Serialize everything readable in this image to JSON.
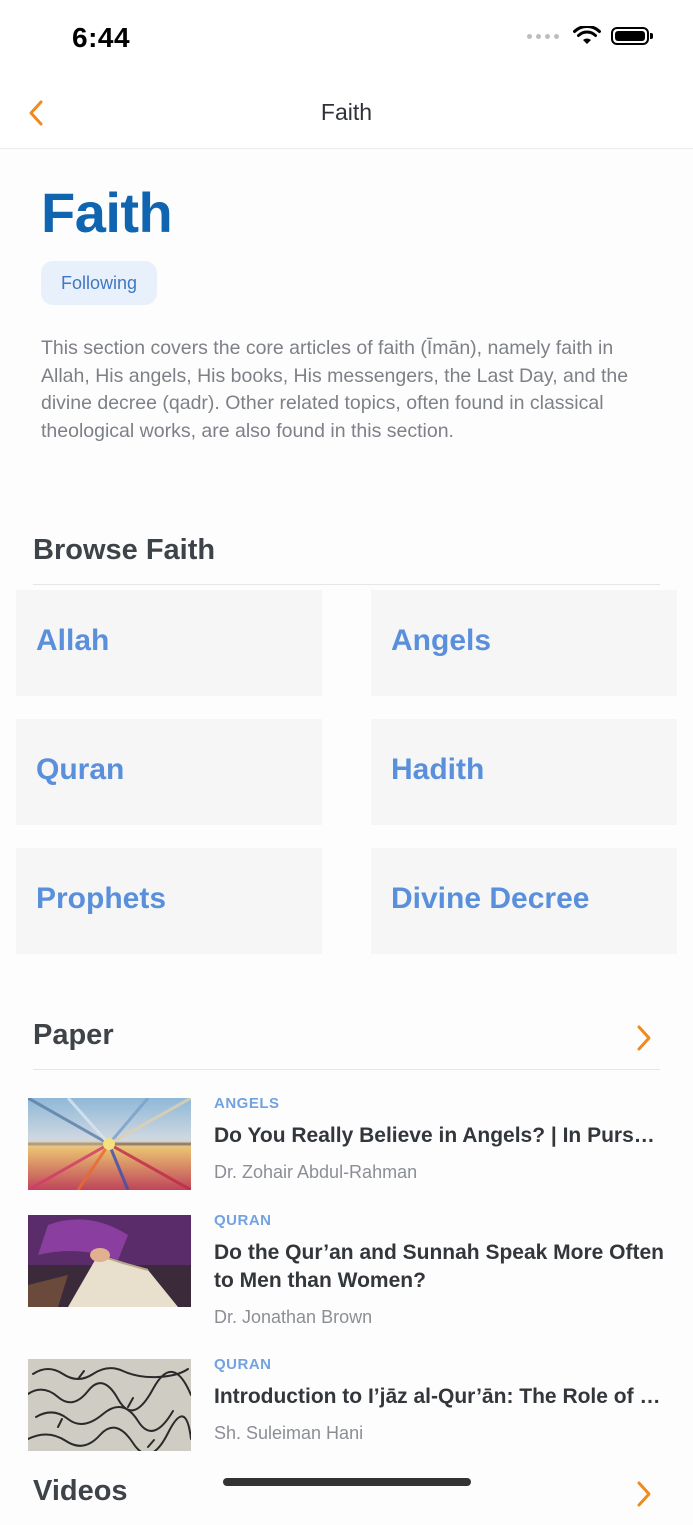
{
  "status": {
    "time": "6:44"
  },
  "nav": {
    "title": "Faith"
  },
  "header": {
    "title": "Faith",
    "follow_label": "Following",
    "description": "This section covers the core articles of faith (Īmān), namely faith in Allah, His angels, His books, His messengers, the Last Day, and the divine decree (qadr). Other related topics, often found in classical theological works, are also found in this section."
  },
  "browse": {
    "title": "Browse Faith",
    "tiles": [
      "Allah",
      "Angels",
      "Quran",
      "Hadith",
      "Prophets",
      "Divine Decree"
    ]
  },
  "paper": {
    "title": "Paper",
    "articles": [
      {
        "category": "ANGELS",
        "title": "Do You Really Believe in Angels? | In Pursuit of Certainty",
        "author": "Dr. Zohair Abdul-Rahman"
      },
      {
        "category": "QURAN",
        "title": "Do the Qur’an and Sunnah Speak More Often to Men than Women?",
        "author": "Dr. Jonathan Brown"
      },
      {
        "category": "QURAN",
        "title": "Introduction to I’jāz al-Qur’ān: The Role of the Qur’an’s Inimitability",
        "author": "Sh. Suleiman Hani"
      }
    ]
  },
  "videos": {
    "title": "Videos"
  },
  "colors": {
    "accent": "#f0891e",
    "title_blue": "#1065b0",
    "tile_text": "#5a90db",
    "category": "#72a2e0"
  },
  "icons": {
    "back": "chevron-left-icon",
    "more": "chevron-right-icon",
    "wifi": "wifi-icon",
    "battery": "battery-icon",
    "signal": "signal-icon"
  }
}
